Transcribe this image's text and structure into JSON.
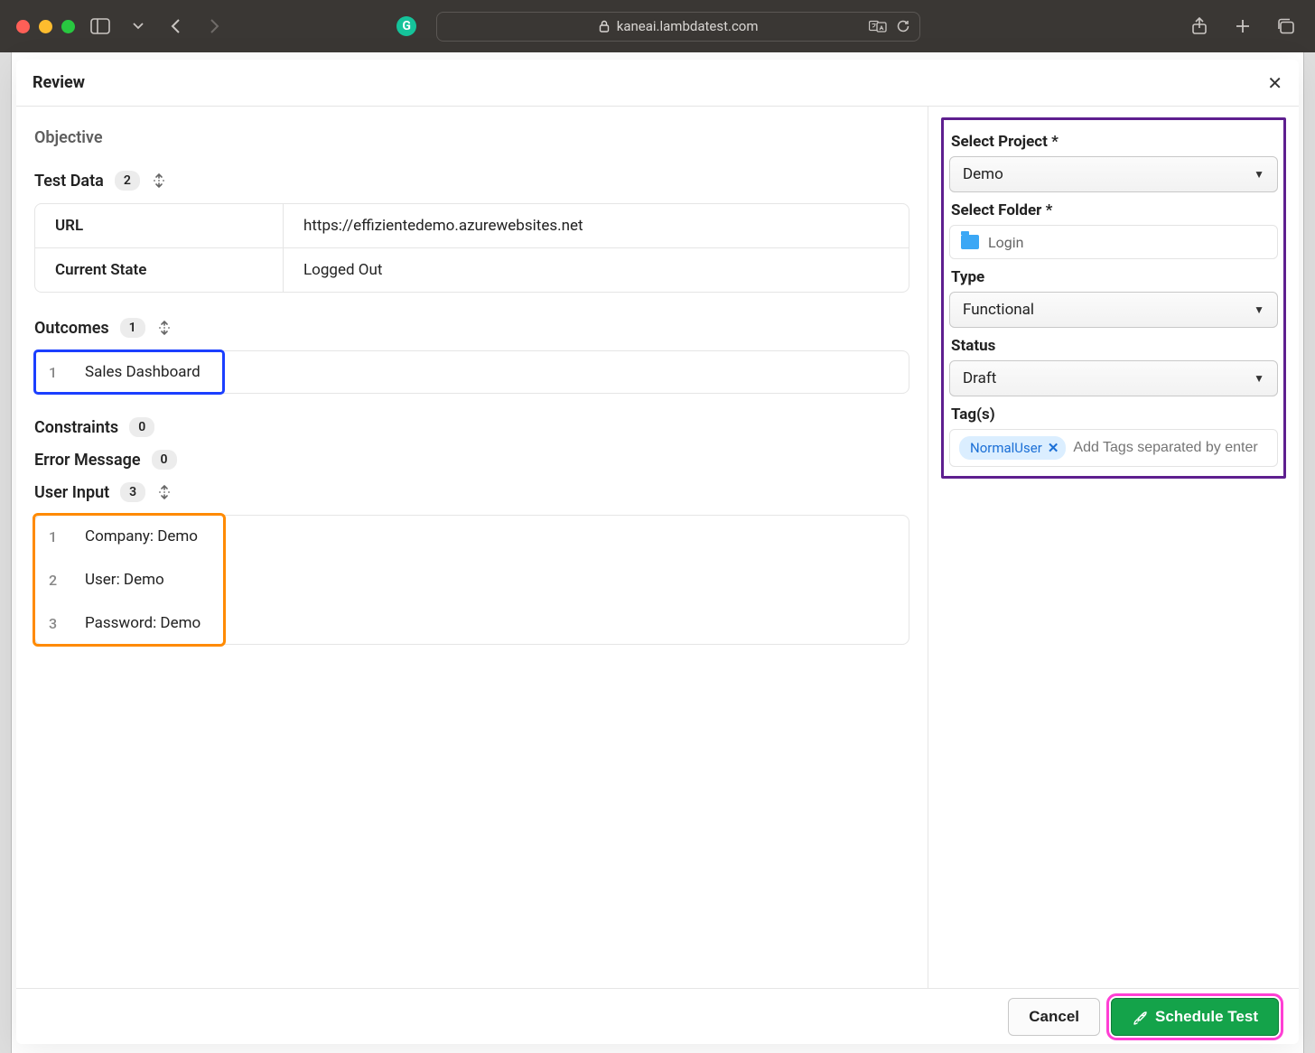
{
  "browser": {
    "url": "kaneai.lambdatest.com"
  },
  "modal": {
    "title": "Review",
    "objective_label": "Objective",
    "sections": {
      "test_data": {
        "label": "Test Data",
        "count": "2",
        "rows": [
          {
            "key": "URL",
            "value": "https://effizientedemo.azurewebsites.net"
          },
          {
            "key": "Current State",
            "value": "Logged Out"
          }
        ]
      },
      "outcomes": {
        "label": "Outcomes",
        "count": "1",
        "items": [
          {
            "num": "1",
            "text": "Sales Dashboard"
          }
        ]
      },
      "constraints": {
        "label": "Constraints",
        "count": "0"
      },
      "error_message": {
        "label": "Error Message",
        "count": "0"
      },
      "user_input": {
        "label": "User Input",
        "count": "3",
        "items": [
          {
            "num": "1",
            "text": "Company: Demo"
          },
          {
            "num": "2",
            "text": "User: Demo"
          },
          {
            "num": "3",
            "text": "Password: Demo"
          }
        ]
      }
    },
    "right": {
      "project_label": "Select Project *",
      "project_value": "Demo",
      "folder_label": "Select Folder *",
      "folder_value": "Login",
      "type_label": "Type",
      "type_value": "Functional",
      "status_label": "Status",
      "status_value": "Draft",
      "tags_label": "Tag(s)",
      "tags": [
        "NormalUser"
      ],
      "tags_placeholder": "Add Tags separated by enter"
    },
    "footer": {
      "cancel": "Cancel",
      "schedule": "Schedule Test"
    }
  }
}
